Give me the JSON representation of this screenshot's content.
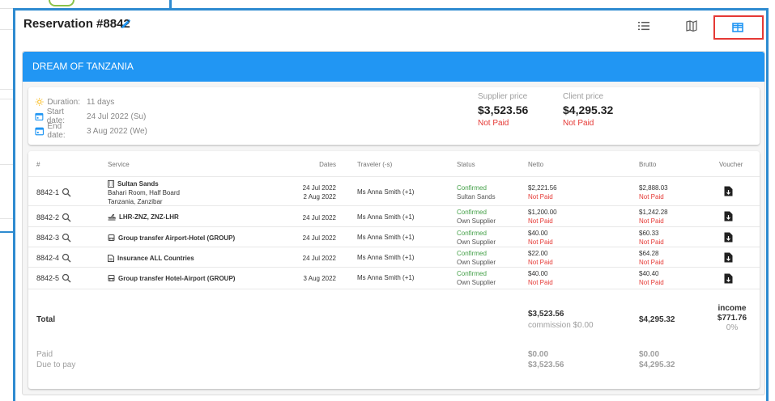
{
  "reservation": {
    "title": "Reservation #8842"
  },
  "view_toggles": [
    {
      "icon": "list-icon"
    },
    {
      "icon": "map-icon"
    },
    {
      "icon": "table-icon",
      "active": true
    }
  ],
  "tour": {
    "name": "DREAM OF TANZANIA",
    "duration_label": "Duration:",
    "duration_value": "11 days",
    "start_label": "Start date:",
    "start_value": "24 Jul 2022 (Su)",
    "end_label": "End date:",
    "end_value": "3 Aug 2022 (We)",
    "supplier_price_label": "Supplier price",
    "supplier_price": "$3,523.56",
    "supplier_status": "Not Paid",
    "client_price_label": "Client price",
    "client_price": "$4,295.32",
    "client_status": "Not Paid"
  },
  "table": {
    "headers": {
      "id": "#",
      "service": "Service",
      "dates": "Dates",
      "traveler": "Traveler (-s)",
      "status": "Status",
      "netto": "Netto",
      "brutto": "Brutto",
      "voucher": "Voucher"
    },
    "rows": [
      {
        "id": "8842-1",
        "service": "Sultan Sands",
        "service_sub1": "Bahari Room, Half Board",
        "service_sub2": "Tanzania, Zanzibar",
        "date1": "24 Jul 2022",
        "date2": "2 Aug 2022",
        "traveler": "Ms Anna Smith (+1)",
        "status": "Confirmed",
        "supplier": "Sultan Sands",
        "netto": "$2,221.56",
        "netto_status": "Not Paid",
        "brutto": "$2,888.03",
        "brutto_status": "Not Paid"
      },
      {
        "id": "8842-2",
        "service": "LHR-ZNZ, ZNZ-LHR",
        "date1": "24 Jul 2022",
        "traveler": "Ms Anna Smith (+1)",
        "status": "Confirmed",
        "supplier": "Own Supplier",
        "netto": "$1,200.00",
        "netto_status": "Not Paid",
        "brutto": "$1,242.28",
        "brutto_status": "Not Paid"
      },
      {
        "id": "8842-3",
        "service": "Group transfer Airport-Hotel (GROUP)",
        "date1": "24 Jul 2022",
        "traveler": "Ms Anna Smith (+1)",
        "status": "Confirmed",
        "supplier": "Own Supplier",
        "netto": "$40.00",
        "netto_status": "Not Paid",
        "brutto": "$60.33",
        "brutto_status": "Not Paid"
      },
      {
        "id": "8842-4",
        "service": "Insurance ALL Countries",
        "date1": "24 Jul 2022",
        "traveler": "Ms Anna Smith (+1)",
        "status": "Confirmed",
        "supplier": "Own Supplier",
        "netto": "$22.00",
        "netto_status": "Not Paid",
        "brutto": "$64.28",
        "brutto_status": "Not Paid"
      },
      {
        "id": "8842-5",
        "service": "Group transfer Hotel-Airport (GROUP)",
        "date1": "3 Aug 2022",
        "traveler": "Ms Anna Smith (+1)",
        "status": "Confirmed",
        "supplier": "Own Supplier",
        "netto": "$40.00",
        "netto_status": "Not Paid",
        "brutto": "$40.40",
        "brutto_status": "Not Paid"
      }
    ],
    "total": {
      "label": "Total",
      "netto": "$3,523.56",
      "commission": "commission $0.00",
      "brutto": "$4,295.32",
      "income_label": "income",
      "income_value": "$771.76",
      "income_pct": "0%"
    },
    "paid": {
      "label": "Paid",
      "netto": "$0.00",
      "brutto": "$0.00"
    },
    "due": {
      "label": "Due to pay",
      "netto": "$3,523.56",
      "brutto": "$4,295.32"
    }
  },
  "colors": {
    "accent": "#2196f3",
    "frame": "#2e8bd0",
    "confirmed": "#43a047",
    "not_paid": "#e53935",
    "highlight": "#e53935"
  }
}
